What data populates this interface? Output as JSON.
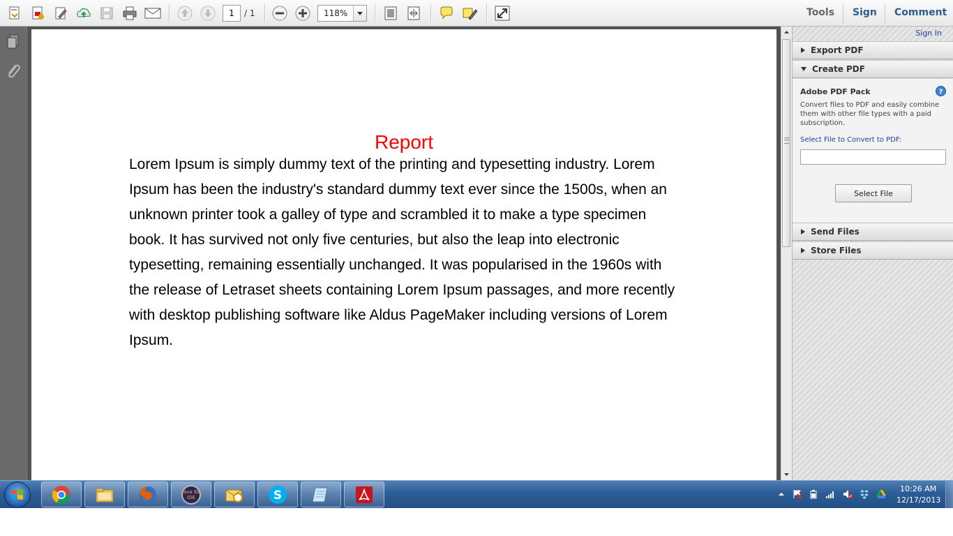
{
  "toolbar": {
    "page_current": "1",
    "page_total": "/ 1",
    "zoom": "118%",
    "tools_label": "Tools",
    "sign_label": "Sign",
    "comment_label": "Comment",
    "icons": [
      "create-pdf-icon",
      "convert-pdf-icon",
      "edit-icon",
      "upload-icon",
      "save-icon",
      "print-icon",
      "email-icon",
      "prev-page-icon",
      "next-page-icon",
      "zoom-out-icon",
      "zoom-in-icon",
      "fit-page-icon",
      "fit-width-icon",
      "comment-icon",
      "highlight-icon",
      "fullscreen-icon"
    ]
  },
  "document": {
    "title": "Report",
    "body": "Lorem Ipsum is simply dummy text of the printing and typesetting industry. Lorem Ipsum has been the industry's standard dummy text ever since the 1500s, when an unknown printer took a galley of type and scrambled it to make a type specimen book. It has survived not only five centuries, but also the leap into electronic typesetting, remaining essentially unchanged. It was popularised in the 1960s with the release of Letraset sheets containing Lorem Ipsum passages, and more recently with desktop publishing software like Aldus PageMaker including versions of Lorem Ipsum.",
    "title_color": "#ff0000"
  },
  "right_panel": {
    "sign_in": "Sign In",
    "sections": [
      {
        "label": "Export PDF",
        "expanded": false
      },
      {
        "label": "Create PDF",
        "expanded": true
      },
      {
        "label": "Send Files",
        "expanded": false
      },
      {
        "label": "Store Files",
        "expanded": false
      }
    ],
    "create": {
      "pack_title": "Adobe PDF Pack",
      "description": "Convert files to PDF and easily combine them with other file types with a paid subscription.",
      "select_label": "Select File to Convert to PDF:",
      "file_value": "",
      "button_label": "Select File"
    }
  },
  "taskbar": {
    "apps": [
      "chrome",
      "file-explorer",
      "firefox",
      "java-ee-ide",
      "outlook",
      "skype",
      "notepad",
      "adobe-reader"
    ],
    "java_label_1": "Java EE",
    "java_label_2": "IDE",
    "time": "10:26 AM",
    "date": "12/17/2013"
  }
}
